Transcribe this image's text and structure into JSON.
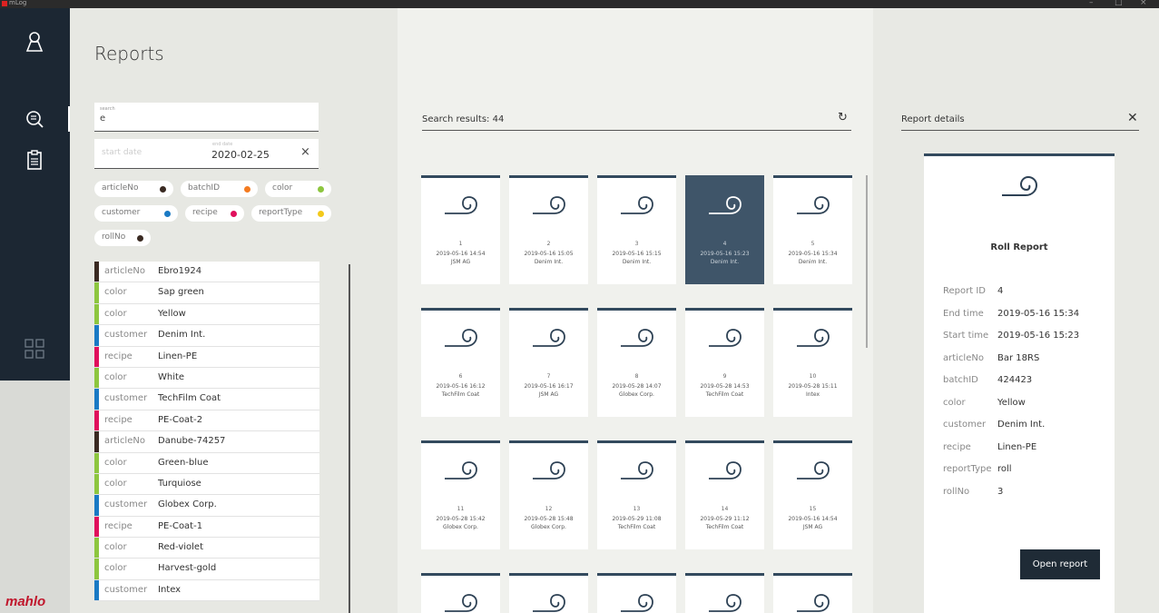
{
  "window": {
    "title": "mLog",
    "controls": [
      "–",
      "□",
      "×"
    ]
  },
  "brand": "mahlo",
  "page": {
    "title": "Reports"
  },
  "search": {
    "label": "search",
    "value": "e"
  },
  "date_filter": {
    "start_placeholder": "start date",
    "end_label": "end date",
    "end_value": "2020-02-25",
    "clear": "×"
  },
  "tags": [
    {
      "label": "articleNo",
      "color": "#3a2a22"
    },
    {
      "label": "batchID",
      "color": "#f47b20"
    },
    {
      "label": "color",
      "color": "#8dc63f"
    },
    {
      "label": "customer",
      "color": "#1a7ac4"
    },
    {
      "label": "recipe",
      "color": "#e0105c"
    },
    {
      "label": "reportType",
      "color": "#f3c91b"
    },
    {
      "label": "rollNo",
      "color": "#3a2a22"
    }
  ],
  "list": [
    {
      "key": "articleNo",
      "value": "Ebro1924",
      "color": "#3a2a22"
    },
    {
      "key": "color",
      "value": "Sap green",
      "color": "#8dc63f"
    },
    {
      "key": "color",
      "value": "Yellow",
      "color": "#8dc63f"
    },
    {
      "key": "customer",
      "value": "Denim Int.",
      "color": "#1a7ac4"
    },
    {
      "key": "recipe",
      "value": "Linen-PE",
      "color": "#e0105c"
    },
    {
      "key": "color",
      "value": "White",
      "color": "#8dc63f"
    },
    {
      "key": "customer",
      "value": "TechFilm Coat",
      "color": "#1a7ac4"
    },
    {
      "key": "recipe",
      "value": "PE-Coat-2",
      "color": "#e0105c"
    },
    {
      "key": "articleNo",
      "value": "Danube-74257",
      "color": "#3a2a22"
    },
    {
      "key": "color",
      "value": "Green-blue",
      "color": "#8dc63f"
    },
    {
      "key": "color",
      "value": "Turquiose",
      "color": "#8dc63f"
    },
    {
      "key": "customer",
      "value": "Globex Corp.",
      "color": "#1a7ac4"
    },
    {
      "key": "recipe",
      "value": "PE-Coat-1",
      "color": "#e0105c"
    },
    {
      "key": "color",
      "value": "Red-violet",
      "color": "#8dc63f"
    },
    {
      "key": "color",
      "value": "Harvest-gold",
      "color": "#8dc63f"
    },
    {
      "key": "customer",
      "value": "Intex",
      "color": "#1a7ac4"
    }
  ],
  "results": {
    "header": "Search results: 44",
    "cards": [
      {
        "id": "1",
        "date": "2019-05-16 14:54",
        "customer": "JSM AG"
      },
      {
        "id": "2",
        "date": "2019-05-16 15:05",
        "customer": "Denim Int."
      },
      {
        "id": "3",
        "date": "2019-05-16 15:15",
        "customer": "Denim Int."
      },
      {
        "id": "4",
        "date": "2019-05-16 15:23",
        "customer": "Denim Int.",
        "selected": true
      },
      {
        "id": "5",
        "date": "2019-05-16 15:34",
        "customer": "Denim Int."
      },
      {
        "id": "6",
        "date": "2019-05-16 16:12",
        "customer": "TechFilm Coat"
      },
      {
        "id": "7",
        "date": "2019-05-16 16:17",
        "customer": "JSM AG"
      },
      {
        "id": "8",
        "date": "2019-05-28 14:07",
        "customer": "Globex Corp."
      },
      {
        "id": "9",
        "date": "2019-05-28 14:53",
        "customer": "TechFilm Coat"
      },
      {
        "id": "10",
        "date": "2019-05-28 15:11",
        "customer": "Intex"
      },
      {
        "id": "11",
        "date": "2019-05-28 15:42",
        "customer": "Globex Corp."
      },
      {
        "id": "12",
        "date": "2019-05-28 15:48",
        "customer": "Globex Corp."
      },
      {
        "id": "13",
        "date": "2019-05-29 11:08",
        "customer": "TechFilm Coat"
      },
      {
        "id": "14",
        "date": "2019-05-29 11:12",
        "customer": "TechFilm Coat"
      },
      {
        "id": "15",
        "date": "2019-05-16 14:54",
        "customer": "JSM AG"
      },
      {
        "id": "",
        "date": "",
        "customer": ""
      },
      {
        "id": "",
        "date": "",
        "customer": ""
      },
      {
        "id": "",
        "date": "",
        "customer": ""
      },
      {
        "id": "",
        "date": "",
        "customer": ""
      },
      {
        "id": "",
        "date": "",
        "customer": ""
      }
    ]
  },
  "details": {
    "header": "Report details",
    "title": "Roll Report",
    "rows": [
      {
        "key": "Report ID",
        "value": "4"
      },
      {
        "key": "End time",
        "value": "2019-05-16 15:34"
      },
      {
        "key": "Start time",
        "value": "2019-05-16 15:23"
      },
      {
        "key": "articleNo",
        "value": "Bar 18RS"
      },
      {
        "key": "batchID",
        "value": "424423"
      },
      {
        "key": "color",
        "value": "Yellow"
      },
      {
        "key": "customer",
        "value": "Denim Int."
      },
      {
        "key": "recipe",
        "value": "Linen-PE"
      },
      {
        "key": "reportType",
        "value": "roll"
      },
      {
        "key": "rollNo",
        "value": "3"
      }
    ],
    "open_button": "Open report"
  }
}
